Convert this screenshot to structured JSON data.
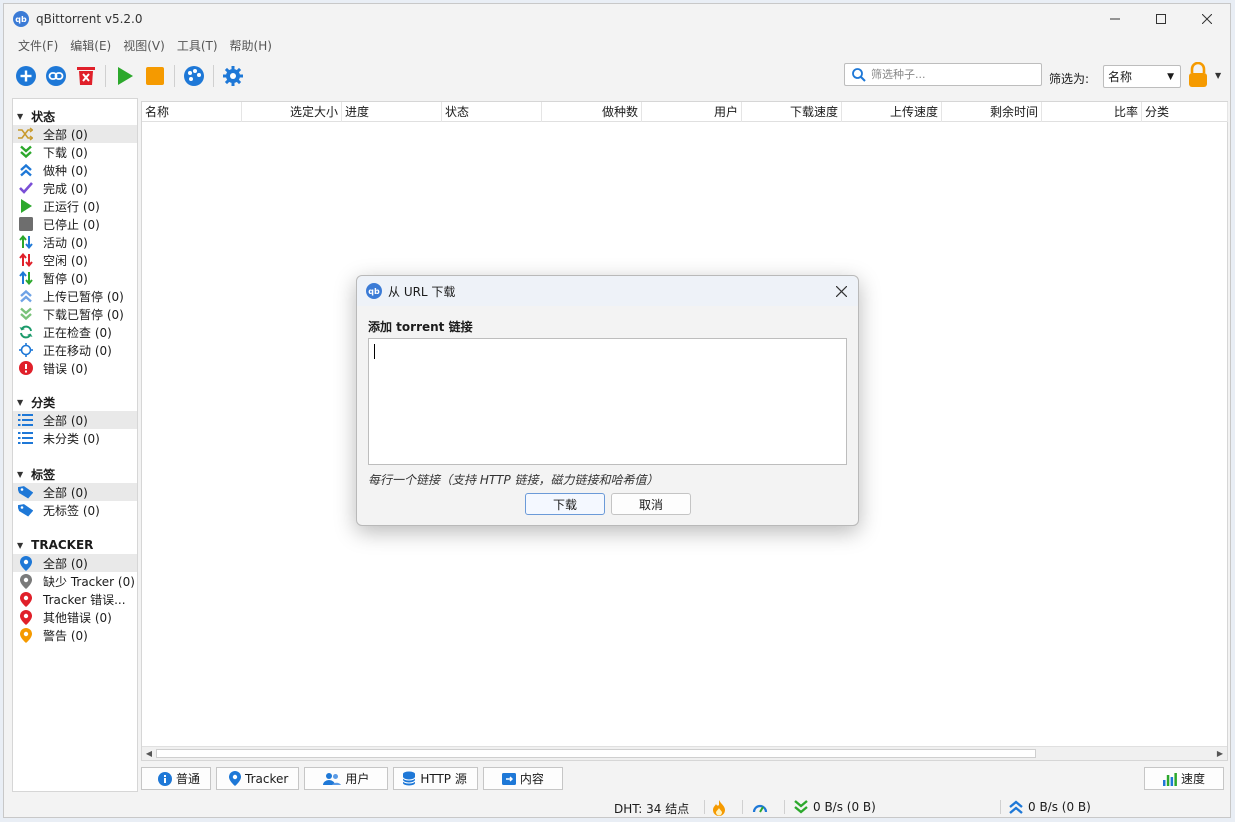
{
  "window": {
    "title": "qBittorrent v5.2.0",
    "icon_text": "qb",
    "controls": [
      "minimize",
      "maximize",
      "close"
    ]
  },
  "menu": [
    "文件(F)",
    "编辑(E)",
    "视图(V)",
    "工具(T)",
    "帮助(H)"
  ],
  "toolbar": {
    "buttons": [
      "add-torrent-icon",
      "add-link-icon",
      "delete-icon",
      "resume-icon",
      "stop-icon",
      "remote-control-icon",
      "options-icon"
    ],
    "search_placeholder": "筛选种子...",
    "filter_label": "筛选为:",
    "filter_value": "名称"
  },
  "sidebar": {
    "status": {
      "header": "状态",
      "items": [
        {
          "label": "全部 (0)",
          "icon": "shuffle-icon",
          "selected": true
        },
        {
          "label": "下载 (0)",
          "icon": "download-chevrons-icon"
        },
        {
          "label": "做种 (0)",
          "icon": "seeding-chevrons-icon"
        },
        {
          "label": "完成 (0)",
          "icon": "check-icon"
        },
        {
          "label": "正运行 (0)",
          "icon": "play-icon"
        },
        {
          "label": "已停止 (0)",
          "icon": "stop-square-icon"
        },
        {
          "label": "活动 (0)",
          "icon": "active-arrows-icon"
        },
        {
          "label": "空闲 (0)",
          "icon": "idle-arrows-icon"
        },
        {
          "label": "暂停 (0)",
          "icon": "paused-arrows-icon"
        },
        {
          "label": "上传已暂停 (0)",
          "icon": "upload-paused-icon"
        },
        {
          "label": "下载已暂停 (0)",
          "icon": "download-paused-icon"
        },
        {
          "label": "正在检查 (0)",
          "icon": "refresh-icon"
        },
        {
          "label": "正在移动 (0)",
          "icon": "move-icon"
        },
        {
          "label": "错误 (0)",
          "icon": "error-icon"
        }
      ]
    },
    "categories": {
      "header": "分类",
      "items": [
        {
          "label": "全部 (0)",
          "icon": "list-icon",
          "selected": true
        },
        {
          "label": "未分类 (0)",
          "icon": "list-icon"
        }
      ]
    },
    "tags": {
      "header": "标签",
      "items": [
        {
          "label": "全部 (0)",
          "icon": "tag-icon",
          "selected": true
        },
        {
          "label": "无标签 (0)",
          "icon": "tag-icon"
        }
      ]
    },
    "trackers": {
      "header": "TRACKER",
      "items": [
        {
          "label": "全部 (0)",
          "icon": "pin-blue-icon",
          "selected": true
        },
        {
          "label": "缺少 Tracker (0)",
          "icon": "pin-gray-icon"
        },
        {
          "label": "Tracker 错误...",
          "icon": "pin-red-icon"
        },
        {
          "label": "其他错误 (0)",
          "icon": "pin-red-icon"
        },
        {
          "label": "警告 (0)",
          "icon": "pin-orange-icon"
        }
      ]
    }
  },
  "columns": [
    "名称",
    "选定大小",
    "进度",
    "状态",
    "做种数",
    "用户",
    "下载速度",
    "上传速度",
    "剩余时间",
    "比率",
    "分类"
  ],
  "tabs": [
    {
      "label": "普通",
      "icon": "info-icon"
    },
    {
      "label": "Tracker",
      "icon": "pin-icon"
    },
    {
      "label": "用户",
      "icon": "users-icon"
    },
    {
      "label": "HTTP 源",
      "icon": "database-icon"
    },
    {
      "label": "内容",
      "icon": "content-icon"
    }
  ],
  "speed_tab": "速度",
  "statusbar": {
    "dht": "DHT:  34 结点",
    "download": "0 B/s (0 B)",
    "upload": "0 B/s (0 B)"
  },
  "dialog": {
    "title": "从 URL 下载",
    "label": "添加 torrent 链接",
    "hint": "每行一个链接（支持 HTTP 链接，磁力链接和哈希值）",
    "ok": "下载",
    "cancel": "取消"
  },
  "colors": {
    "accent": "#1e78d7",
    "green": "#2ca82c",
    "orange": "#f59a00",
    "red": "#e0202a"
  }
}
